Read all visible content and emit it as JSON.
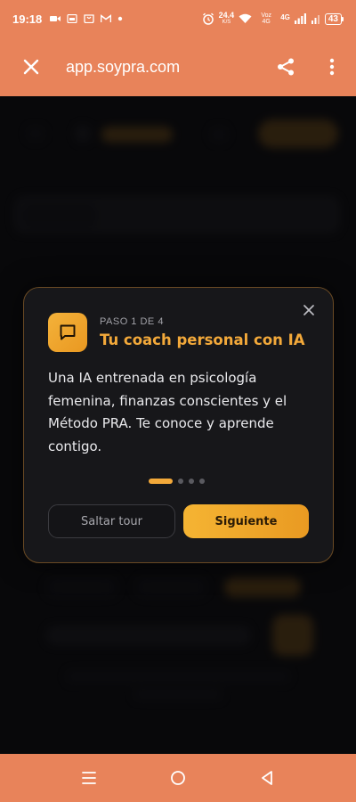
{
  "status_bar": {
    "time": "19:18",
    "net_speed_value": "24.4",
    "net_speed_unit": "K/S",
    "carrier": "Voz 4G",
    "network": "4G",
    "battery": "43"
  },
  "browser": {
    "url": "app.soypra.com"
  },
  "tour": {
    "step": "PASO 1 DE 4",
    "title": "Tu coach personal con IA",
    "body": "Una IA entrenada en psicología femenina, finanzas conscientes y el Método PRA. Te conoce y aprende contigo.",
    "skip_label": "Saltar tour",
    "next_label": "Siguiente",
    "current_step": 1,
    "total_steps": 4
  },
  "colors": {
    "accent": "#f3a93a",
    "chrome": "#e8835a",
    "card_bg": "#17171a",
    "card_border": "#6a4a24"
  },
  "icons": {
    "close": "close-icon",
    "share": "share-icon",
    "menu": "more-vertical-icon",
    "tour_icon": "chat-bubble-icon",
    "tour_close": "close-icon"
  }
}
